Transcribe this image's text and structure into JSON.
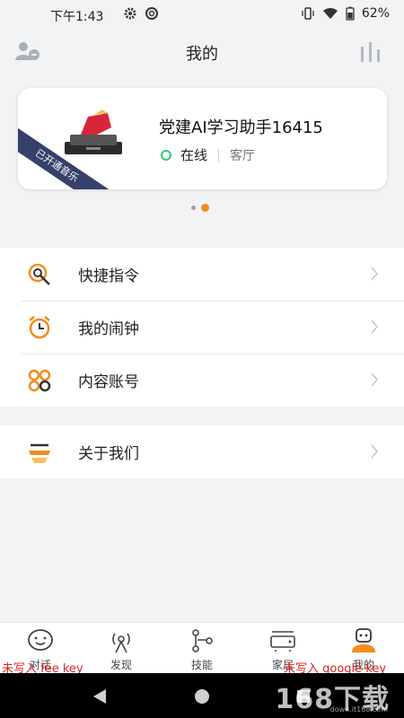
{
  "status_bar": {
    "time": "下午1:43",
    "battery": "62%"
  },
  "header": {
    "title": "我的"
  },
  "device_card": {
    "name": "党建AI学习助手16415",
    "status": "在线",
    "room": "客厅",
    "badge": "已开通音乐"
  },
  "pager": {
    "pages": 2,
    "active": 2
  },
  "menu": {
    "group1": [
      {
        "label": "快捷指令",
        "icon": "shortcut-icon"
      },
      {
        "label": "我的闹钟",
        "icon": "alarm-clock-icon"
      },
      {
        "label": "内容账号",
        "icon": "content-account-icon"
      }
    ],
    "group2": [
      {
        "label": "关于我们",
        "icon": "about-icon"
      }
    ]
  },
  "bottom_nav": {
    "items": [
      {
        "label": "对话",
        "icon": "chat-icon"
      },
      {
        "label": "发现",
        "icon": "discover-icon"
      },
      {
        "label": "技能",
        "icon": "skills-icon"
      },
      {
        "label": "家居",
        "icon": "home-device-icon"
      },
      {
        "label": "我的",
        "icon": "profile-icon",
        "active": true
      }
    ]
  },
  "overlays": {
    "left": "未写入 fee key",
    "right": "未写入 google key"
  },
  "watermark": {
    "main": "168下载",
    "sub": "down.it168.com"
  },
  "colors": {
    "accent": "#f28c1e",
    "online": "#2ecc71",
    "ribbon": "#35416b"
  }
}
